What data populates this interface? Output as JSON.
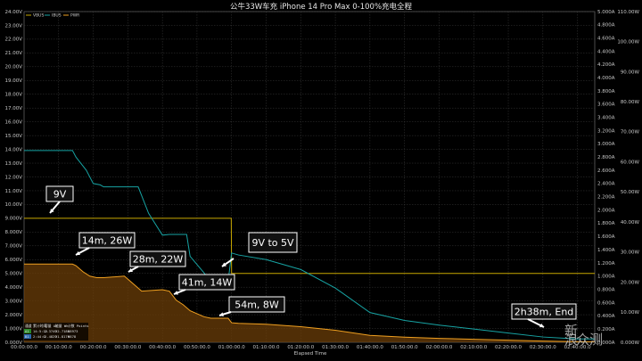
{
  "chart_data": {
    "type": "line",
    "title": "公牛33W车充 iPhone 14 Pro Max 0-100%充电全程",
    "xlabel": "Elapsed Time",
    "x_unit": "minutes",
    "xlim": [
      0,
      165
    ],
    "x_ticks": [
      {
        "value": 0,
        "label": "00:00:00.0"
      },
      {
        "value": 10,
        "label": "00:10:00.0"
      },
      {
        "value": 20,
        "label": "00:20:00.0"
      },
      {
        "value": 30,
        "label": "00:30:00.0"
      },
      {
        "value": 40,
        "label": "00:40:00.0"
      },
      {
        "value": 50,
        "label": "00:50:00.0"
      },
      {
        "value": 60,
        "label": "01:00:00.0"
      },
      {
        "value": 70,
        "label": "01:10:00.0"
      },
      {
        "value": 80,
        "label": "01:20:00.0"
      },
      {
        "value": 90,
        "label": "01:30:00.0"
      },
      {
        "value": 100,
        "label": "01:40:00.0"
      },
      {
        "value": 110,
        "label": "01:50:00.0"
      },
      {
        "value": 120,
        "label": "02:00:00.0"
      },
      {
        "value": 130,
        "label": "02:10:00.0"
      },
      {
        "value": 140,
        "label": "02:20:00.0"
      },
      {
        "value": 150,
        "label": "02:30:00.0"
      },
      {
        "value": 160,
        "label": "02:40:00.0"
      }
    ],
    "y_left": {
      "unit": "V",
      "lim": [
        0,
        24
      ],
      "tick_labels": [
        "0.000V",
        "1.000V",
        "2.000V",
        "3.000V",
        "4.000V",
        "5.000V",
        "6.000V",
        "7.000V",
        "8.000V",
        "9.000V",
        "10.00V",
        "11.00V",
        "12.00V",
        "13.00V",
        "14.00V",
        "15.00V",
        "16.00V",
        "17.00V",
        "18.00V",
        "19.00V",
        "20.00V",
        "21.00V",
        "22.00V",
        "23.00V",
        "24.00V"
      ]
    },
    "y_right_current": {
      "unit": "A",
      "lim": [
        0,
        5
      ],
      "tick_labels": [
        "0.000A",
        "0.200A",
        "0.400A",
        "0.600A",
        "0.800A",
        "1.000A",
        "1.200A",
        "1.400A",
        "1.600A",
        "1.800A",
        "2.000A",
        "2.200A",
        "2.400A",
        "2.600A",
        "2.800A",
        "3.000A",
        "3.200A",
        "3.400A",
        "3.600A",
        "3.800A",
        "4.000A",
        "4.200A",
        "4.400A",
        "4.600A",
        "4.800A",
        "5.000A"
      ]
    },
    "y_right_power": {
      "unit": "W",
      "lim": [
        0,
        110
      ],
      "tick_labels": [
        "0.000W",
        "10.00W",
        "20.00W",
        "30.00W",
        "40.00W",
        "50.00W",
        "60.00W",
        "70.00W",
        "80.00W",
        "90.00W",
        "100.00W",
        "110.00W"
      ]
    },
    "grid": true,
    "legend_position": "top-left",
    "series": [
      {
        "name": "VBUS",
        "axis": "voltage",
        "color": "#c8a800",
        "style": "step",
        "x": [
          0,
          59.9,
          60,
          165
        ],
        "y": [
          9.0,
          9.0,
          5.0,
          5.0
        ]
      },
      {
        "name": "IBUS",
        "axis": "current",
        "color": "#17a3a3",
        "style": "line",
        "x": [
          0,
          14,
          15,
          18,
          20,
          22,
          23,
          33,
          36,
          40,
          42,
          47,
          48,
          53,
          55,
          59,
          60,
          62,
          70,
          80,
          90,
          100,
          110,
          120,
          130,
          140,
          150,
          160,
          165
        ],
        "y": [
          2.9,
          2.9,
          2.8,
          2.6,
          2.4,
          2.38,
          2.35,
          2.35,
          1.95,
          1.62,
          1.63,
          1.63,
          1.3,
          0.99,
          0.95,
          0.92,
          1.35,
          1.32,
          1.25,
          1.1,
          0.82,
          0.45,
          0.33,
          0.26,
          0.2,
          0.14,
          0.08,
          0.05,
          0.05
        ]
      },
      {
        "name": "PWR",
        "axis": "power",
        "color": "#f0a020",
        "style": "line",
        "x": [
          0,
          14,
          15,
          17,
          19,
          21,
          23,
          29,
          30,
          32,
          34,
          40,
          42,
          44,
          46,
          48,
          52,
          54,
          59,
          60,
          62,
          70,
          80,
          90,
          100,
          110,
          120,
          130,
          140,
          150,
          160,
          165
        ],
        "y": [
          26,
          26,
          25.5,
          23.5,
          22,
          21.5,
          21.5,
          22,
          21,
          19,
          17,
          17.5,
          17,
          14,
          12.5,
          10.5,
          8.5,
          8,
          8,
          6.5,
          6.3,
          6,
          5.2,
          4,
          2.3,
          1.7,
          1.3,
          1.0,
          0.7,
          0.4,
          0.2,
          0.2
        ]
      }
    ],
    "annotations": [
      {
        "text": "9V"
      },
      {
        "text": "14m, 26W"
      },
      {
        "text": "28m, 22W"
      },
      {
        "text": "41m, 14W"
      },
      {
        "text": "9V to 5V"
      },
      {
        "text": "54m, 8W"
      },
      {
        "text": "2h38m, End"
      }
    ],
    "stats_table": {
      "header": [
        "通道",
        "累计时间",
        "容量 Ah",
        "能量 Wh",
        "计数 Points"
      ],
      "rows": [
        {
          "channel": "A1",
          "time": "14:5:12",
          "capacity": "2.3749",
          "energy": "22.7186",
          "points": "58973",
          "color": "#2a8a2a"
        },
        {
          "channel": "B1",
          "time": "2:44:0",
          "capacity": "2.4829",
          "energy": "21.8176",
          "points": "9878",
          "color": "#2a6ab0"
        }
      ]
    }
  },
  "watermark": {
    "line1": "新",
    "line2": "浪",
    "text": "众测"
  },
  "colors": {
    "background": "#000000",
    "grid": "#3a3a3a",
    "axis": "#808080"
  }
}
